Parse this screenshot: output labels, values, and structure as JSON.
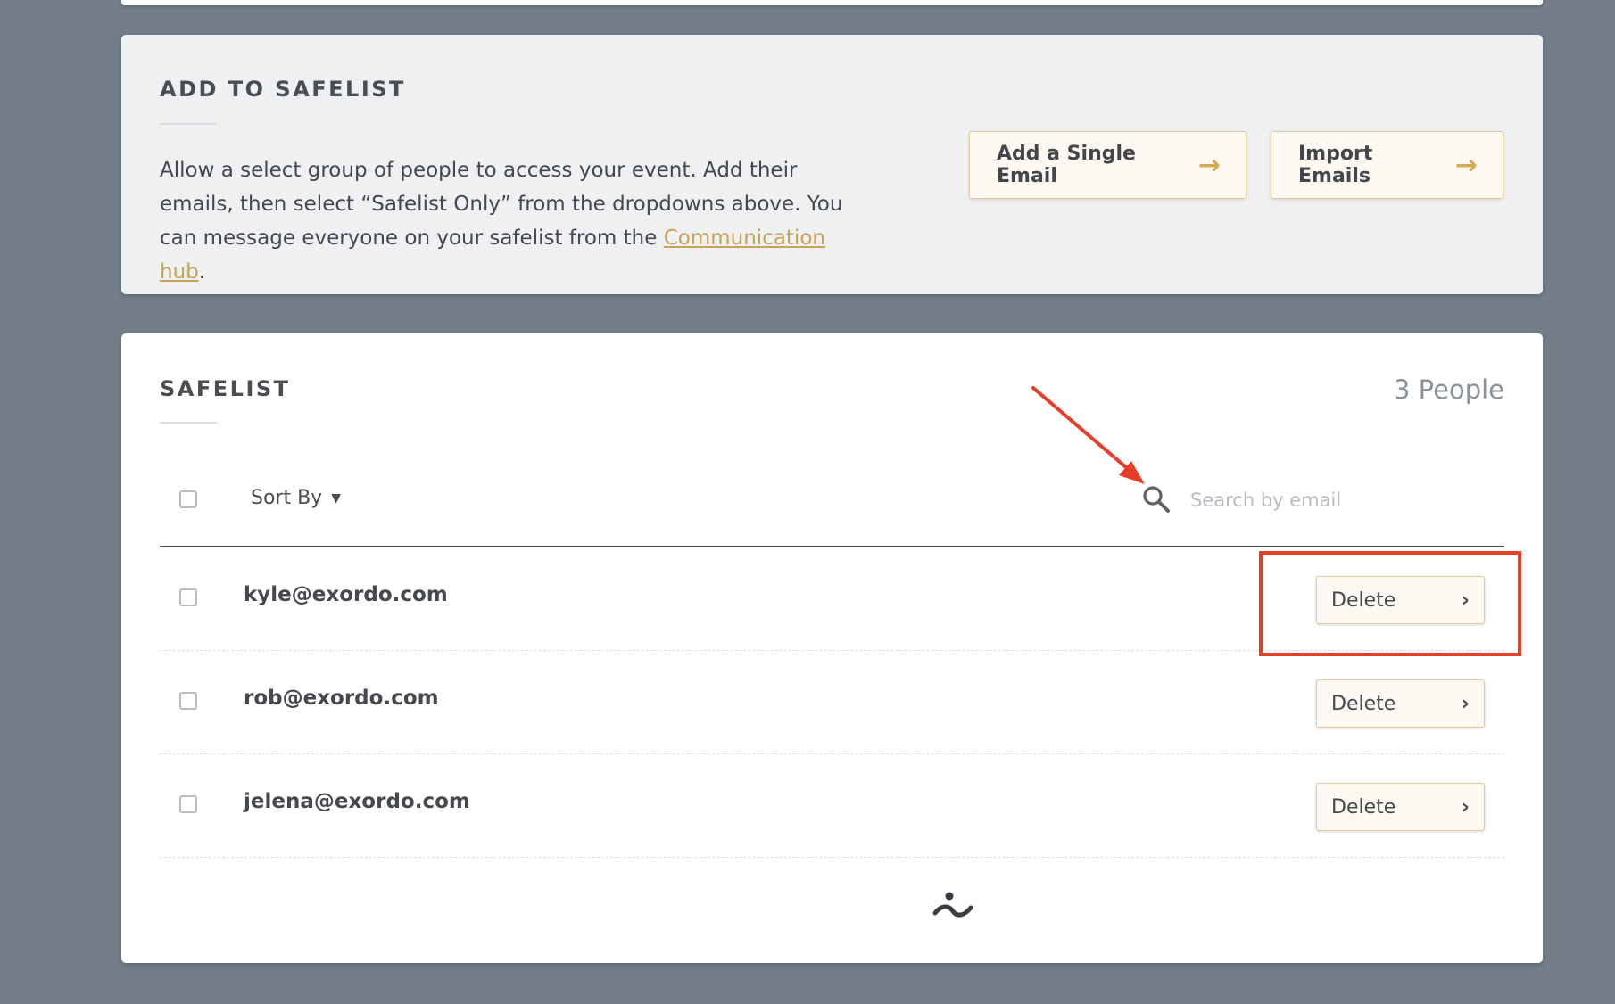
{
  "add_section": {
    "title": "ADD TO SAFELIST",
    "description_before": "Allow a select group of people to access your event. Add their emails, then select “Safelist Only” from the dropdowns above. You can message everyone on your safelist from the ",
    "description_link": "Communication hub",
    "description_after": ".",
    "add_single_label": "Add a Single Email",
    "import_label": "Import Emails"
  },
  "safelist": {
    "title": "SAFELIST",
    "count": "3 People",
    "sort_label": "Sort By",
    "search_placeholder": "Search by email",
    "rows": [
      {
        "email": "kyle@exordo.com",
        "action": "Delete"
      },
      {
        "email": "rob@exordo.com",
        "action": "Delete"
      },
      {
        "email": "jelena@exordo.com",
        "action": "Delete"
      }
    ]
  },
  "colors": {
    "background": "#737e89",
    "accent_gold": "#c8a255",
    "annotation_red": "#e53e2a"
  },
  "icons": {
    "search": "search-icon",
    "sort": "chevron-down-icon",
    "button_arrow": "arrow-right-icon",
    "row_chevron": "chevron-right-icon",
    "brand": "logo-icon"
  }
}
